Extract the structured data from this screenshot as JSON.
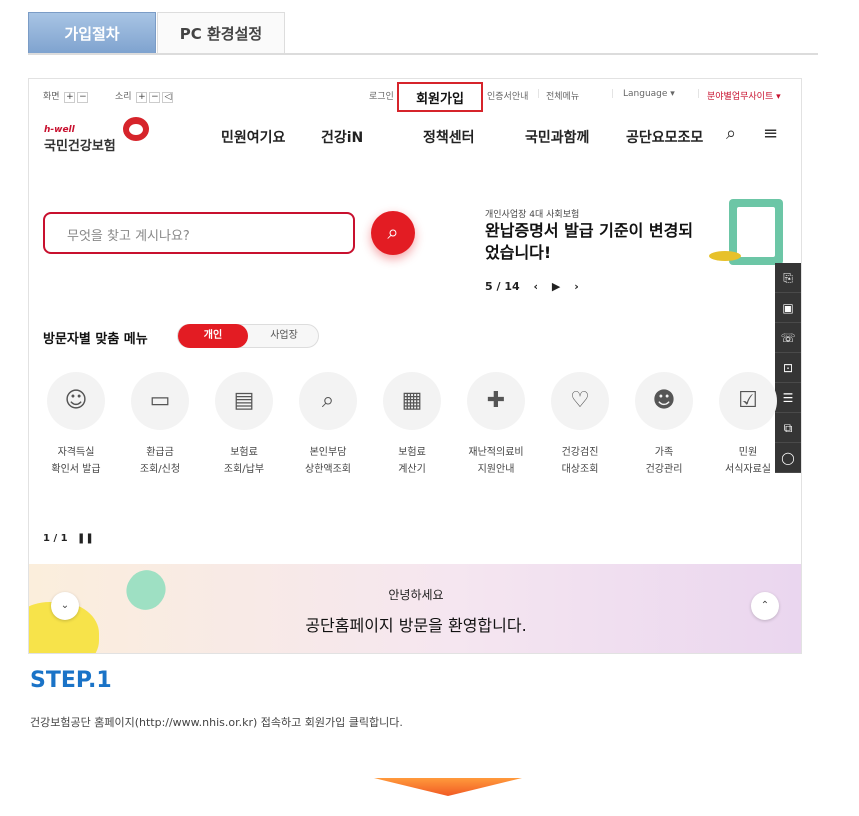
{
  "tabs": [
    {
      "label": "가입절차",
      "active": true
    },
    {
      "label": "PC 환경설정",
      "active": false
    }
  ],
  "util": {
    "screen_label": "화면",
    "sound_label": "소리",
    "plus": "+",
    "minus": "−",
    "login": "로그인",
    "signup": "회원가입",
    "cert": "인증서안내",
    "all_menu": "전체메뉴",
    "language": "Language ▾",
    "field_sites": "분야별업무사이트 ▾"
  },
  "logo": {
    "small": "h-well",
    "main": "국민건강보험"
  },
  "gnb": [
    "민원여기요",
    "건강iN",
    "정책센터",
    "국민과함께",
    "공단요모조모"
  ],
  "search": {
    "placeholder": "무엇을 찾고 계시나요?"
  },
  "banner": {
    "kicker": "개인사업장 4대 사회보험",
    "title": "완납증명서 발급 기준이 변경되었습니다!",
    "pager": "5 / 14",
    "prev": "‹",
    "play": "▶",
    "next": "›"
  },
  "menu": {
    "title": "방문자별 맞춤 메뉴",
    "toggle_on": "개인",
    "toggle_off": "사업장",
    "items": [
      {
        "label": "자격득실\n확인서 발급",
        "icon": "person-certificate-icon"
      },
      {
        "label": "환급금\n조회/신청",
        "icon": "monitor-refund-icon"
      },
      {
        "label": "보험료\n조회/납부",
        "icon": "card-payment-icon"
      },
      {
        "label": "본인부담\n상한액조회",
        "icon": "search-document-icon"
      },
      {
        "label": "보험료\n계산기",
        "icon": "calculator-icon"
      },
      {
        "label": "재난적의료비\n지원안내",
        "icon": "medical-support-icon"
      },
      {
        "label": "건강검진\n대상조회",
        "icon": "health-check-icon"
      },
      {
        "label": "가족\n건강관리",
        "icon": "family-icon"
      },
      {
        "label": "민원\n서식자료실",
        "icon": "form-library-icon"
      }
    ],
    "pager": "1 / 1",
    "pause": "❚❚"
  },
  "welcome": {
    "small": "안녕하세요",
    "big": "공단홈페이지 방문을 환영합니다.",
    "down": "⌄",
    "up": "⌃"
  },
  "step": {
    "title": "STEP.1",
    "desc": "건강보험공단 홈페이지(http://www.nhis.or.kr) 접속하고 회원가입 클릭합니다."
  },
  "colors": {
    "accent": "#e31c23",
    "step_blue": "#1a73c7",
    "tab_blue": "#7fa3cf"
  }
}
